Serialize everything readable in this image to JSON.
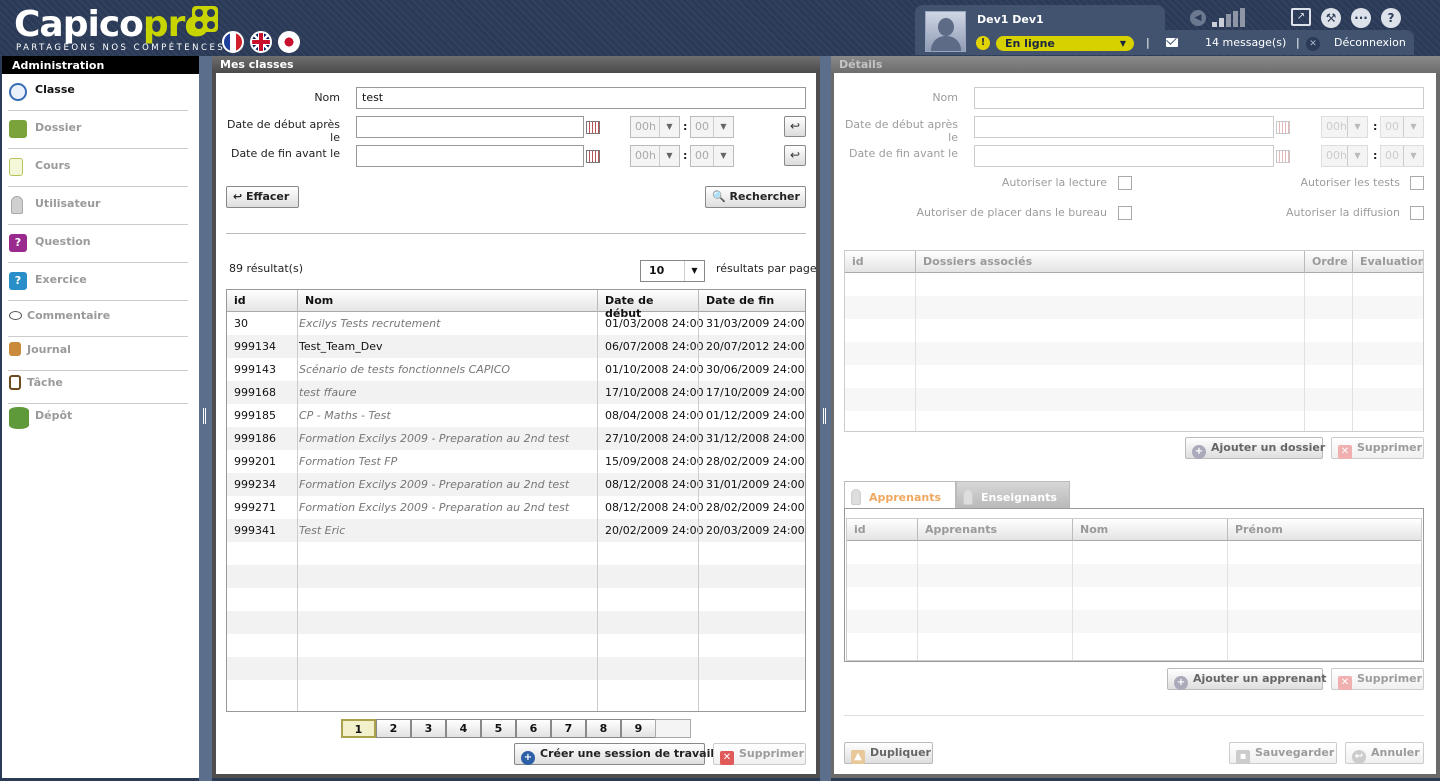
{
  "header": {
    "logo_main": "Capico",
    "logo_pro": "pro",
    "logo_tagline": "PARTAGEONS NOS COMPÉTENCES",
    "languages": [
      "fr-flag-icon",
      "uk-flag-icon",
      "jp-flag-icon"
    ],
    "user": {
      "name": "Dev1 Dev1",
      "status": "En ligne",
      "messages": "14 message(s)",
      "logout": "Déconnexion",
      "sep": "|"
    }
  },
  "sidebar": {
    "title": "Administration",
    "items": [
      {
        "label": "Classe",
        "icon": "compass-icon",
        "active": true
      },
      {
        "label": "Dossier",
        "icon": "book-icon"
      },
      {
        "label": "Cours",
        "icon": "document-icon"
      },
      {
        "label": "Utilisateur",
        "icon": "user-icon"
      },
      {
        "label": "Question",
        "icon": "question-box-icon"
      },
      {
        "label": "Exercice",
        "icon": "exercise-icon"
      },
      {
        "label": "Commentaire",
        "icon": "comment-icon"
      },
      {
        "label": "Journal",
        "icon": "journal-icon"
      },
      {
        "label": "Tâche",
        "icon": "clipboard-icon"
      },
      {
        "label": "Dépôt",
        "icon": "database-icon"
      }
    ]
  },
  "left": {
    "title": "Mes classes",
    "form": {
      "name_label": "Nom",
      "name_value": "test",
      "start_label": "Date de début après le",
      "end_label": "Date de fin avant le",
      "hour_placeholder": "00h",
      "min_placeholder": "00",
      "colon": ":"
    },
    "clear_button": "Effacer",
    "search_button": "Rechercher",
    "results_count": "89 résultat(s)",
    "per_page_value": "10",
    "per_page_label": "résultats par page",
    "table": {
      "columns": [
        "id",
        "Nom",
        "Date de début",
        "Date de fin"
      ],
      "rows": [
        {
          "id": "30",
          "name": "Excilys Tests recrutement",
          "start": "01/03/2008 24:00",
          "end": "31/03/2009 24:00",
          "italic": true
        },
        {
          "id": "999134",
          "name": "Test_Team_Dev",
          "start": "06/07/2008 24:00",
          "end": "20/07/2012 24:00",
          "italic": false
        },
        {
          "id": "999143",
          "name": "Scénario de tests fonctionnels CAPICO",
          "start": "01/10/2008 24:00",
          "end": "30/06/2009 24:00",
          "italic": true
        },
        {
          "id": "999168",
          "name": "test ffaure",
          "start": "17/10/2008 24:00",
          "end": "17/10/2009 24:00",
          "italic": true
        },
        {
          "id": "999185",
          "name": "CP - Maths - Test",
          "start": "08/04/2008 24:00",
          "end": "01/12/2009 24:00",
          "italic": true
        },
        {
          "id": "999186",
          "name": "Formation Excilys 2009 - Preparation au 2nd test",
          "start": "27/10/2008 24:00",
          "end": "31/12/2008 24:00",
          "italic": true
        },
        {
          "id": "999201",
          "name": "Formation Test FP",
          "start": "15/09/2008 24:00",
          "end": "28/02/2009 24:00",
          "italic": true
        },
        {
          "id": "999234",
          "name": "Formation Excilys 2009 - Preparation au 2nd test",
          "start": "08/12/2008 24:00",
          "end": "31/01/2009 24:00",
          "italic": true
        },
        {
          "id": "999271",
          "name": "Formation Excilys 2009 - Preparation au 2nd test",
          "start": "08/12/2008 24:00",
          "end": "28/02/2009 24:00",
          "italic": true
        },
        {
          "id": "999341",
          "name": "Test Eric",
          "start": "20/02/2009 24:00",
          "end": "20/03/2009 24:00",
          "italic": true
        }
      ]
    },
    "pages": [
      "1",
      "2",
      "3",
      "4",
      "5",
      "6",
      "7",
      "8",
      "9"
    ],
    "current_page": "1",
    "create_session_button": "Créer une session de travail",
    "delete_button": "Supprimer"
  },
  "right": {
    "title": "Détails",
    "name_label": "Nom",
    "start_label": "Date de début après le",
    "end_label": "Date de fin avant le",
    "hour_placeholder": "00h",
    "min_placeholder": "00",
    "perm_read": "Autoriser la lecture",
    "perm_tests": "Autoriser les tests",
    "perm_office": "Autoriser de placer dans le bureau",
    "perm_broadcast": "Autoriser la diffusion",
    "folders_table": {
      "columns": [
        "id",
        "Dossiers associés",
        "Ordre",
        "Evaluation"
      ]
    },
    "add_folder_button": "Ajouter un dossier",
    "delete_button": "Supprimer",
    "tabs": [
      "Apprenants",
      "Enseignants"
    ],
    "learners_table": {
      "columns": [
        "id",
        "Apprenants",
        "Nom",
        "Prénom"
      ]
    },
    "add_learner_button": "Ajouter un apprenant",
    "duplicate_button": "Dupliquer",
    "save_button": "Sauvegarder",
    "cancel_button": "Annuler"
  }
}
